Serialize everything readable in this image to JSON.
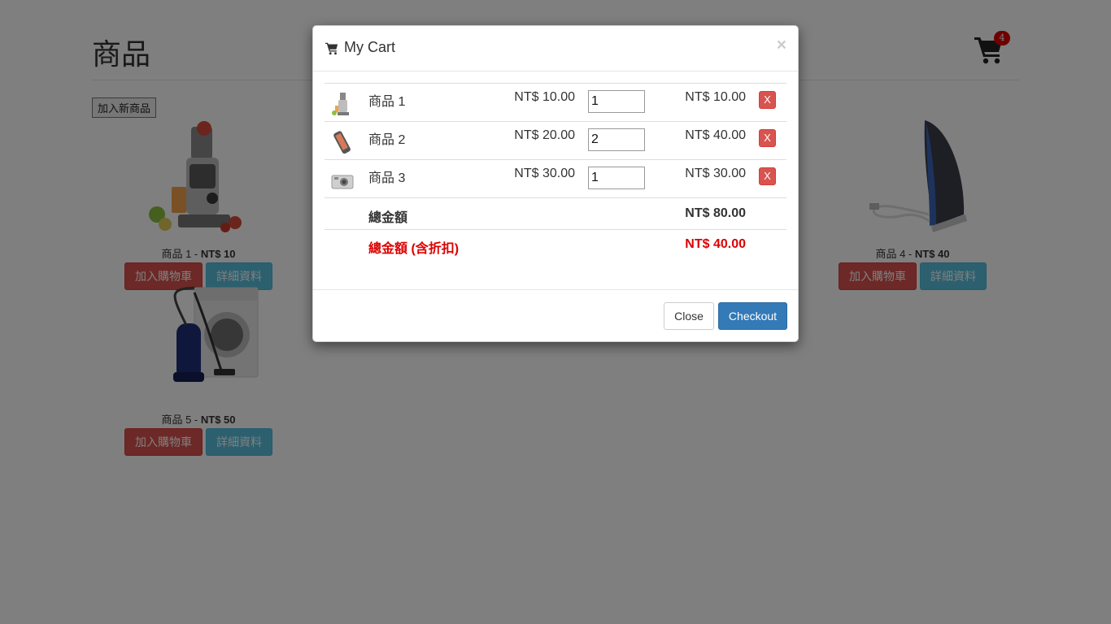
{
  "page": {
    "title": "商品",
    "add_new_label": "加入新商品",
    "cart_count": "4"
  },
  "products": [
    {
      "name": "商品 1",
      "price": "NT$ 10",
      "add_label": "加入購物車",
      "detail_label": "詳細資料",
      "image": "juicer-image"
    },
    {
      "name": "商品 4",
      "price": "NT$ 40",
      "add_label": "加入購物車",
      "detail_label": "詳細資料",
      "image": "iron-image"
    },
    {
      "name": "商品 5",
      "price": "NT$ 50",
      "add_label": "加入購物車",
      "detail_label": "詳細資料",
      "image": "vacuum-washer-image"
    }
  ],
  "modal": {
    "title": "My Cart",
    "close_glyph": "×",
    "items": [
      {
        "image": "juicer-thumb",
        "name": "商品 1",
        "price": "NT$ 10.00",
        "qty": "1",
        "subtotal": "NT$ 10.00",
        "remove_label": "X"
      },
      {
        "image": "phone-thumb",
        "name": "商品 2",
        "price": "NT$ 20.00",
        "qty": "2",
        "subtotal": "NT$ 40.00",
        "remove_label": "X"
      },
      {
        "image": "camera-thumb",
        "name": "商品 3",
        "price": "NT$ 30.00",
        "qty": "1",
        "subtotal": "NT$ 30.00",
        "remove_label": "X"
      }
    ],
    "total_label": "總金額",
    "total_value": "NT$ 80.00",
    "discount_label": "總金額 (含折扣)",
    "discount_value": "NT$ 40.00",
    "close_label": "Close",
    "checkout_label": "Checkout"
  },
  "colors": {
    "danger": "#d9534f",
    "info": "#5bc0de",
    "primary": "#337ab7",
    "discount_text": "#dd0000"
  }
}
